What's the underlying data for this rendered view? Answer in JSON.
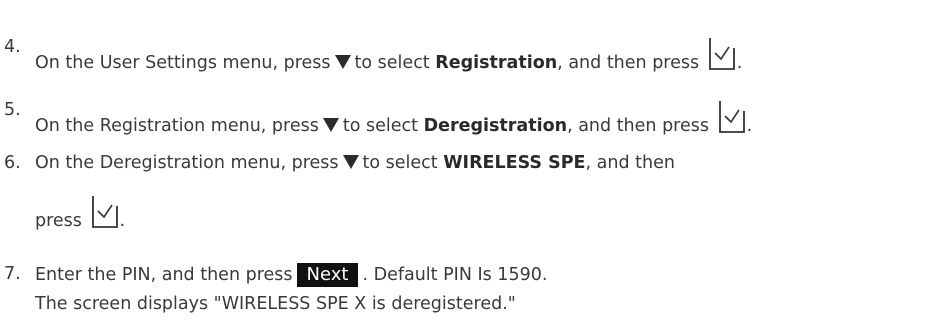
{
  "steps": [
    {
      "number": "4.",
      "pre": "On the User Settings menu, press",
      "mid": "to select",
      "bold": "Registration",
      "post": ", and then press",
      "end": "."
    },
    {
      "number": "5.",
      "pre": "On the Registration menu, press",
      "mid": "to select",
      "bold": "Deregistration",
      "post": ", and then press",
      "end": "."
    },
    {
      "number": "6.",
      "pre": "On the Deregistration menu, press",
      "mid": "to select",
      "bold": "WIRELESS SPE",
      "post": ", and then",
      "line2_pre": "press",
      "end": "."
    },
    {
      "number": "7.",
      "pre": "Enter the PIN, and then press",
      "button": "Next",
      "post": ". Default PIN Is 1590.",
      "line2": "The screen displays \"WIRELESS SPE X is deregistered.\""
    }
  ],
  "icons": {
    "down": "down-triangle-icon",
    "ok": "checkmark-button-icon"
  }
}
